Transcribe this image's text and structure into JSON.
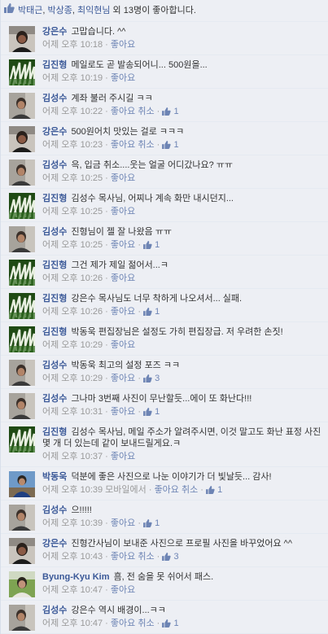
{
  "like_bar": {
    "names": [
      "박태근",
      "박상종",
      "최익현님"
    ],
    "rest": " 외 13명이 좋아합니다."
  },
  "labels": {
    "like": "좋아요",
    "cancel": "취소"
  },
  "comments": [
    {
      "name": "강은수",
      "text": "고맙습니다. ^^",
      "time": "어제 오후 10:18",
      "action": "좋아요",
      "cancel": "",
      "count": "",
      "avatar": "dark"
    },
    {
      "name": "김진형",
      "text": "메일로도 곧 발송되어니... 500원을...",
      "time": "어제 오후 10:19",
      "action": "좋아요",
      "cancel": "",
      "count": "",
      "avatar": "green"
    },
    {
      "name": "김성수",
      "text": "계좌 불러 주시길 ㅋㅋ",
      "time": "어제 오후 10:22",
      "action": "좋아요",
      "cancel": "취소",
      "count": "1",
      "avatar": "gray"
    },
    {
      "name": "강은수",
      "text": "500원어치 맛있는 걸로 ㅋㅋㅋ",
      "time": "어제 오후 10:23",
      "action": "좋아요",
      "cancel": "취소",
      "count": "1",
      "avatar": "dark"
    },
    {
      "name": "김성수",
      "text": "윽, 입금 취소....웃는 얼굴 어디갔나요? ㅠㅠ",
      "time": "어제 오후 10:25",
      "action": "좋아요",
      "cancel": "",
      "count": "",
      "avatar": "gray"
    },
    {
      "name": "김진형",
      "text": "김성수 목사님, 어찌나 계속 화만 내시던지...",
      "time": "어제 오후 10:25",
      "action": "좋아요",
      "cancel": "",
      "count": "",
      "avatar": "green"
    },
    {
      "name": "김성수",
      "text": "진형님이 젤 잘 나왔음 ㅠㅠ",
      "time": "어제 오후 10:25",
      "action": "좋아요",
      "cancel": "",
      "count": "1",
      "avatar": "gray"
    },
    {
      "name": "김진형",
      "text": "그건 제가 제일 젊어서...ㅋ",
      "time": "어제 오후 10:26",
      "action": "좋아요",
      "cancel": "",
      "count": "",
      "avatar": "green"
    },
    {
      "name": "김진형",
      "text": "강은수 목사님도 너무 착하게 나오셔서... 실패.",
      "time": "어제 오후 10:26",
      "action": "좋아요",
      "cancel": "",
      "count": "1",
      "avatar": "green"
    },
    {
      "name": "김진형",
      "text": "박동욱 편집장님은 설정도 가히 편집장급. 저 우려한 손짓!",
      "time": "어제 오후 10:29",
      "action": "좋아요",
      "cancel": "",
      "count": "",
      "avatar": "green"
    },
    {
      "name": "김성수",
      "text": "박동욱 최고의 설정 포즈 ㅋㅋ",
      "time": "어제 오후 10:29",
      "action": "좋아요",
      "cancel": "",
      "count": "3",
      "avatar": "gray"
    },
    {
      "name": "김성수",
      "text": "그나마 3번째 사진이 무난할듯...에이 또 화난다!!!",
      "time": "어제 오후 10:31",
      "action": "좋아요",
      "cancel": "",
      "count": "1",
      "avatar": "gray"
    },
    {
      "name": "김진형",
      "text": "김성수 목사님, 메일 주소가 알려주시면, 이것 말고도 화난 표정 사진 몇 개 더 있는데 같이 보내드릴게요.ㅋ",
      "time": "어제 오후 10:37",
      "action": "좋아요",
      "cancel": "",
      "count": "",
      "avatar": "green",
      "tall": true
    },
    {
      "name": "박동욱",
      "text": "덕분에 좋은 사진으로 나눈 이야기가 더 빛날듯... 감사!",
      "time": "어제 오후 10:39 모바일에서",
      "action": "좋아요",
      "cancel": "취소",
      "count": "1",
      "avatar": "blue"
    },
    {
      "name": "김성수",
      "text": "으!!!!!",
      "time": "어제 오후 10:39",
      "action": "좋아요",
      "cancel": "",
      "count": "1",
      "avatar": "gray"
    },
    {
      "name": "강은수",
      "text": "진형간사님이 보내준 사진으로 프로필 사진을 바꾸었어요 ^^",
      "time": "어제 오후 10:43",
      "action": "좋아요",
      "cancel": "취소",
      "count": "3",
      "avatar": "dark"
    },
    {
      "name": "Byung-Kyu Kim",
      "text": "흠, 전 숨을 못 쉬어서 패스.",
      "time": "어제 오후 10:47",
      "action": "좋아요",
      "cancel": "",
      "count": "",
      "avatar": "grass"
    },
    {
      "name": "김성수",
      "text": "강은수 역시 배경이...ㅋㅋ",
      "time": "어제 오후 10:47",
      "action": "좋아요",
      "cancel": "취소",
      "count": "1",
      "avatar": "gray"
    }
  ]
}
